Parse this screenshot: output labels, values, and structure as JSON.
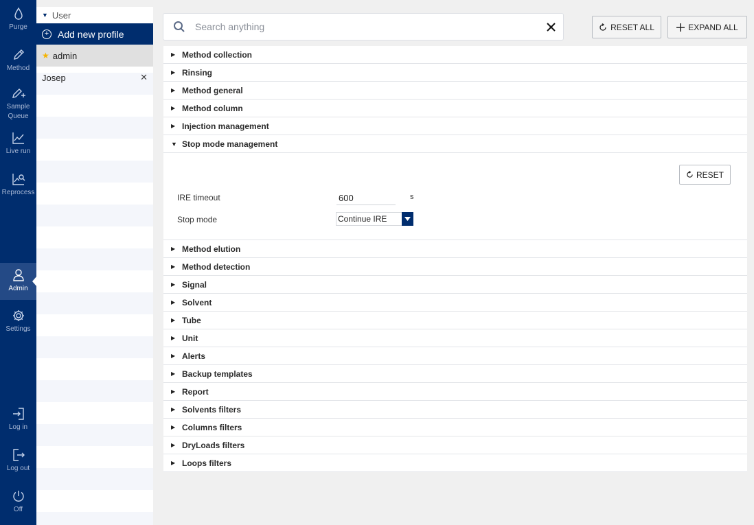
{
  "nav": {
    "items": [
      {
        "label": "Purge",
        "icon": "droplet-icon"
      },
      {
        "label": "Method",
        "icon": "pencil-icon"
      },
      {
        "label": "Sample Queue",
        "icon": "pencil-plus-icon"
      },
      {
        "label": "Live run",
        "icon": "line-chart-icon"
      },
      {
        "label": "Reprocess",
        "icon": "chart-search-icon"
      },
      {
        "label": "Admin",
        "icon": "user-icon",
        "active": true
      },
      {
        "label": "Settings",
        "icon": "gear-icon"
      },
      {
        "label": "Log in",
        "icon": "login-icon"
      },
      {
        "label": "Log out",
        "icon": "logout-icon"
      },
      {
        "label": "Off",
        "icon": "power-icon"
      }
    ]
  },
  "profiles": {
    "header": "User",
    "add_label": "Add new profile",
    "rows": [
      {
        "name": "admin",
        "selected": true,
        "starred": true
      },
      {
        "name": "Josep",
        "selected": false,
        "removable": true
      }
    ]
  },
  "search": {
    "placeholder": "Search anything",
    "value": ""
  },
  "toolbar": {
    "reset_all_label": "RESET ALL",
    "expand_all_label": "EXPAND ALL"
  },
  "sections": [
    {
      "title": "Method collection",
      "expanded": false
    },
    {
      "title": "Rinsing",
      "expanded": false
    },
    {
      "title": "Method general",
      "expanded": false
    },
    {
      "title": "Method column",
      "expanded": false
    },
    {
      "title": "Injection management",
      "expanded": false
    },
    {
      "title": "Stop mode management",
      "expanded": true
    },
    {
      "title": "Method elution",
      "expanded": false
    },
    {
      "title": "Method detection",
      "expanded": false
    },
    {
      "title": "Signal",
      "expanded": false
    },
    {
      "title": "Solvent",
      "expanded": false
    },
    {
      "title": "Tube",
      "expanded": false
    },
    {
      "title": "Unit",
      "expanded": false
    },
    {
      "title": "Alerts",
      "expanded": false
    },
    {
      "title": "Backup templates",
      "expanded": false
    },
    {
      "title": "Report",
      "expanded": false
    },
    {
      "title": "Solvents filters",
      "expanded": false
    },
    {
      "title": "Columns filters",
      "expanded": false
    },
    {
      "title": "DryLoads filters",
      "expanded": false
    },
    {
      "title": "Loops filters",
      "expanded": false
    }
  ],
  "stop_mode": {
    "reset_label": "RESET",
    "ire_timeout_label": "IRE timeout",
    "ire_timeout_value": "600",
    "ire_timeout_unit": "s",
    "stop_mode_label": "Stop mode",
    "stop_mode_value": "Continue IRE"
  },
  "colors": {
    "nav_bg": "#002d6e",
    "accent": "#002d6e",
    "star": "#f6b400"
  }
}
